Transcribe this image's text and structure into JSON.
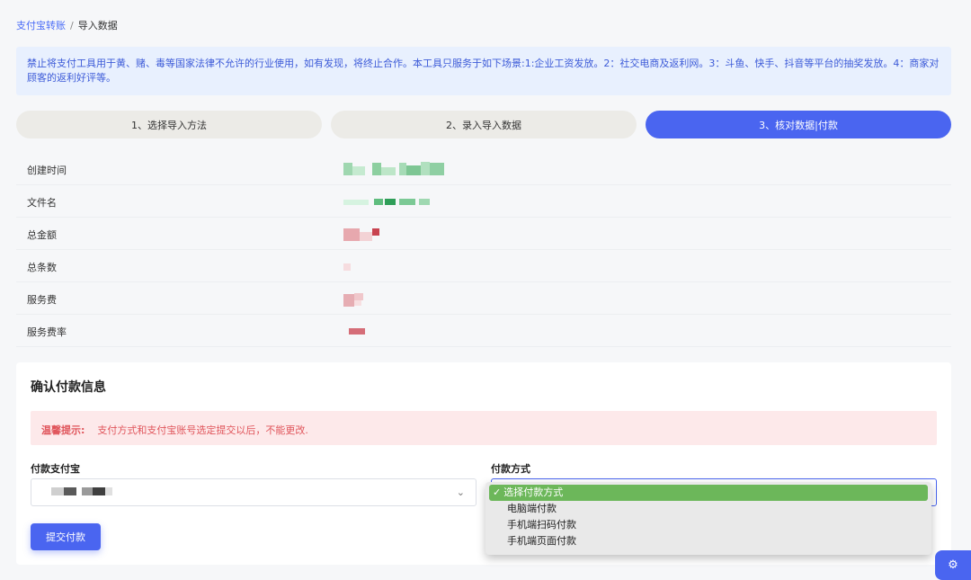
{
  "breadcrumb": {
    "parent": "支付宝转账",
    "separator": "/",
    "current": "导入数据"
  },
  "notice": {
    "text": "禁止将支付工具用于黄、赌、毒等国家法律不允许的行业使用，如有发现，将终止合作。本工具只服务于如下场景:1:企业工资发放。2：社交电商及返利网。3：斗鱼、快手、抖音等平台的抽奖发放。4：商家对顾客的返利好评等。"
  },
  "steps": [
    {
      "label": "1、选择导入方法",
      "active": false
    },
    {
      "label": "2、录入导入数据",
      "active": false
    },
    {
      "label": "3、核对数据|付款",
      "active": true
    }
  ],
  "info": {
    "rows": [
      {
        "label": "创建时间"
      },
      {
        "label": "文件名"
      },
      {
        "label": "总金额"
      },
      {
        "label": "总条数"
      },
      {
        "label": "服务费"
      },
      {
        "label": "服务费率"
      }
    ]
  },
  "confirm": {
    "title": "确认付款信息",
    "warning_lead": "温馨提示:",
    "warning_text": "支付方式和支付宝账号选定提交以后，不能更改.",
    "account_label": "付款支付宝",
    "method_label": "付款方式",
    "submit_label": "提交付款"
  },
  "method_options": [
    {
      "label": "选择付款方式",
      "selected": true
    },
    {
      "label": "电脑端付款",
      "selected": false
    },
    {
      "label": "手机端扫码付款",
      "selected": false
    },
    {
      "label": "手机端页面付款",
      "selected": false
    }
  ],
  "icons": {
    "chevron": "chevron-down-icon",
    "settings": "gear-icon",
    "check": "check-icon"
  },
  "colors": {
    "accent": "#4a65f0",
    "selected_option": "#6cb75a",
    "warning": "#e0555b"
  }
}
